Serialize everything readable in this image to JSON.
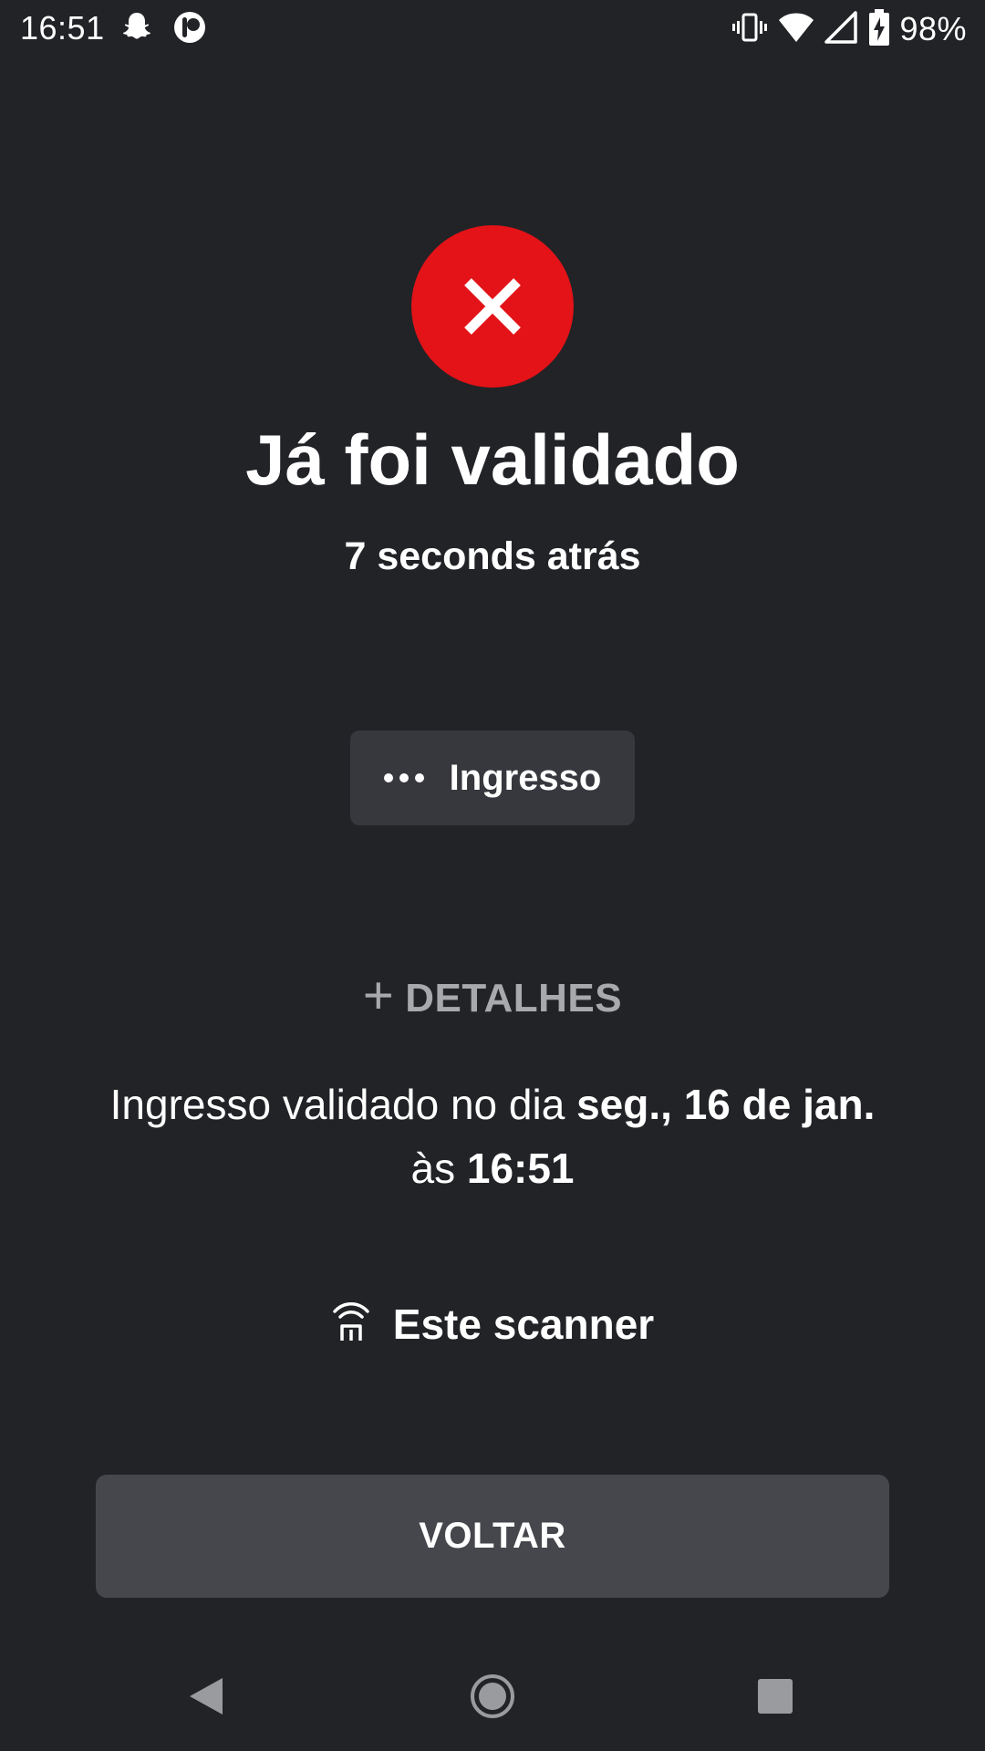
{
  "status_bar": {
    "time": "16:51",
    "left_icons": [
      "snapchat-icon",
      "app-notification-icon"
    ],
    "right_icons": [
      "vibrate-icon",
      "wifi-icon",
      "signal-icon",
      "battery-charging-icon"
    ],
    "battery_percent": "98%"
  },
  "result": {
    "status_icon": "close-icon",
    "status_color": "#e31317",
    "title": "Já foi validado",
    "subtitle": "7 seconds atrás"
  },
  "ticket_chip": {
    "icon": "more-dots-icon",
    "label": "Ingresso"
  },
  "details": {
    "toggle_icon": "plus-icon",
    "toggle_label": "DETALHES",
    "validated_prefix": "Ingresso validado no dia",
    "validated_date": "seg., 16 de jan.",
    "time_prefix": "às",
    "validated_time": "16:51",
    "scanner_icon": "scanner-wifi-icon",
    "scanner_label": "Este scanner"
  },
  "actions": {
    "back_label": "VOLTAR"
  },
  "nav_bar": {
    "back_icon": "nav-back-icon",
    "home_icon": "nav-home-icon",
    "recents_icon": "nav-recents-icon"
  },
  "colors": {
    "background": "#222327",
    "chip": "#36383d",
    "button": "#46474c",
    "muted_text": "#a8a9ad",
    "error": "#e31317"
  }
}
